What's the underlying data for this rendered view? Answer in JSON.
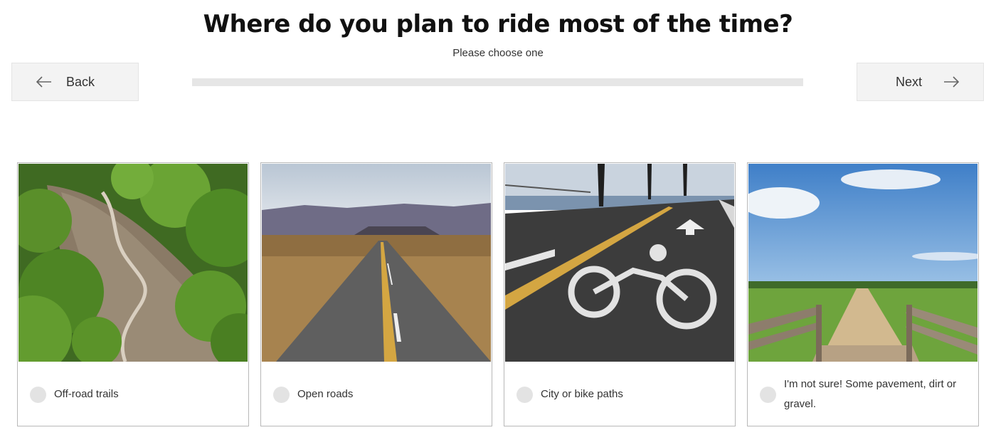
{
  "header": {
    "title": "Where do you plan to ride most of the time?",
    "subtitle": "Please choose one"
  },
  "nav": {
    "back_label": "Back",
    "next_label": "Next",
    "back_icon": "arrow-left-icon",
    "next_icon": "arrow-right-icon"
  },
  "progress": {
    "value": 0
  },
  "options": [
    {
      "label": "Off-road trails",
      "image": "mountain-trail-photo"
    },
    {
      "label": "Open roads",
      "image": "desert-highway-photo"
    },
    {
      "label": "City or bike paths",
      "image": "bike-lane-photo"
    },
    {
      "label": "I'm not sure! Some pavement, dirt or gravel.",
      "image": "boardwalk-path-photo"
    }
  ]
}
